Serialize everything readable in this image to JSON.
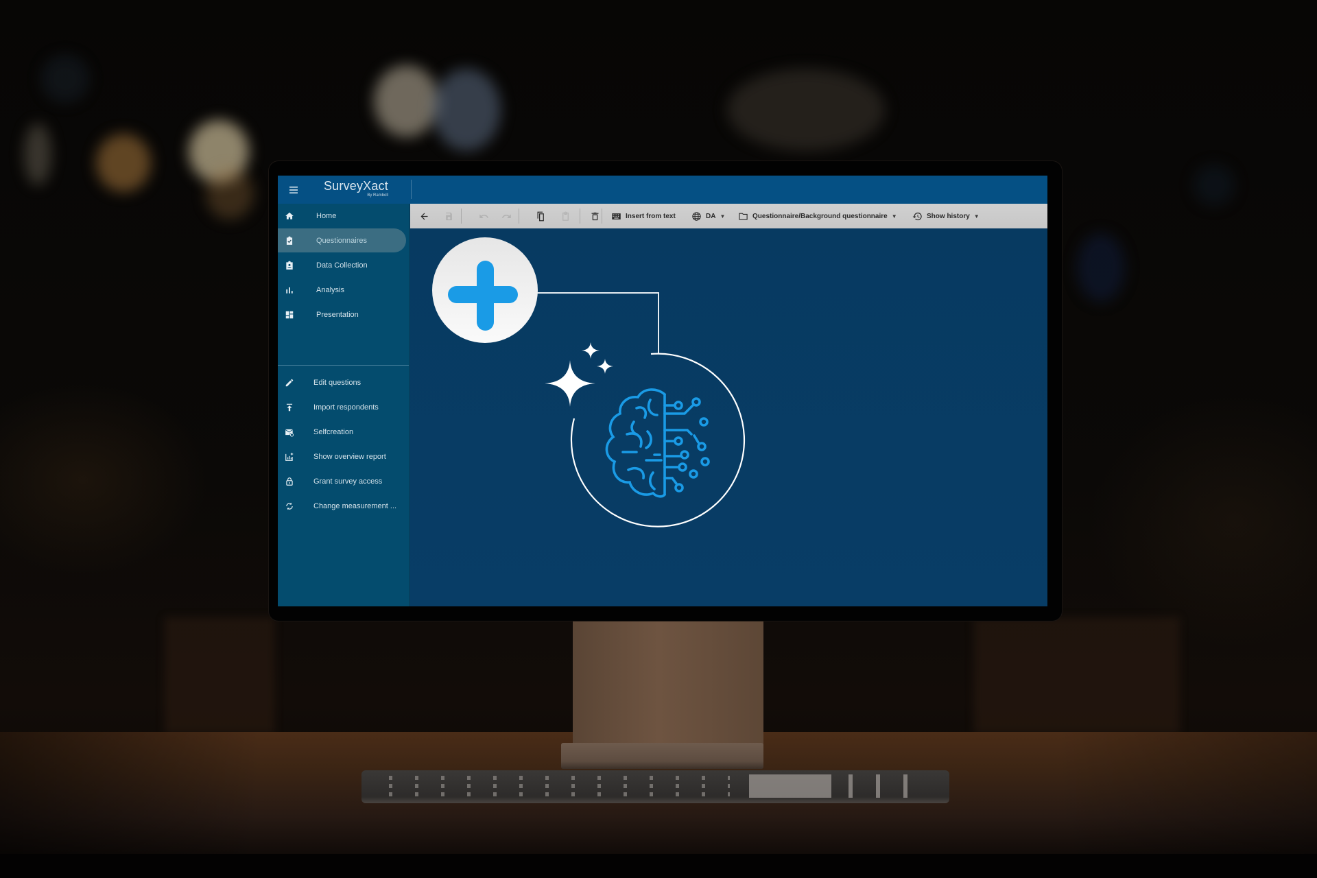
{
  "app": {
    "name": "SurveyXact",
    "byline": "By Ramboll"
  },
  "sidebar": {
    "primary_items": [
      {
        "label": "Home",
        "icon": "home-icon",
        "active": false
      },
      {
        "label": "Questionnaires",
        "icon": "clipboard-check-icon",
        "active": true
      },
      {
        "label": "Data Collection",
        "icon": "badge-person-icon",
        "active": false
      },
      {
        "label": "Analysis",
        "icon": "bar-chart-icon",
        "active": false
      },
      {
        "label": "Presentation",
        "icon": "dashboard-icon",
        "active": false
      }
    ],
    "secondary_items": [
      {
        "label": "Edit questions",
        "icon": "pencil-icon"
      },
      {
        "label": "Import respondents",
        "icon": "upload-icon"
      },
      {
        "label": "Selfcreation",
        "icon": "mail-click-icon"
      },
      {
        "label": "Show overview report",
        "icon": "report-add-icon"
      },
      {
        "label": "Grant survey access",
        "icon": "lock-open-icon"
      },
      {
        "label": "Change measurement ...",
        "icon": "sync-icon"
      }
    ]
  },
  "toolbar": {
    "back": {
      "icon": "arrow-left-icon",
      "enabled": true
    },
    "save": {
      "icon": "save-icon",
      "enabled": false
    },
    "undo": {
      "icon": "undo-icon",
      "enabled": false
    },
    "redo": {
      "icon": "redo-icon",
      "enabled": false
    },
    "copy": {
      "icon": "copy-icon",
      "enabled": true
    },
    "paste": {
      "icon": "paste-icon",
      "enabled": false
    },
    "delete": {
      "icon": "trash-icon",
      "enabled": true
    },
    "insert_from_text": "Insert from text",
    "language": "DA",
    "folder_path": "Questionnaire/Background questionnaire",
    "show_history": "Show history"
  },
  "illustration": {
    "elements": [
      "plus-badge",
      "connector-line",
      "sparkles",
      "ai-brain-circuit"
    ],
    "colors": {
      "accent_blue": "#1a9be6",
      "badge_white": "#f4f4f4",
      "line_white": "#ffffff"
    }
  },
  "theme": {
    "header_bg": "#055084",
    "sidebar_bg": "#044c6e",
    "sidebar_active_bg": "#3b6d82",
    "main_bg": "#083b62",
    "toolbar_bg": "#cccccc"
  }
}
